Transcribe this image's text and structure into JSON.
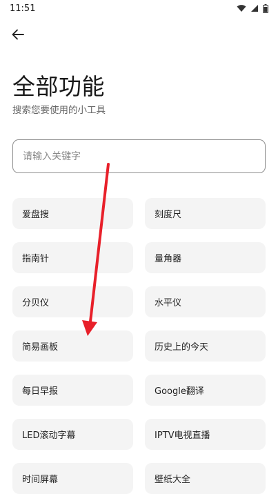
{
  "status_bar": {
    "time": "11:51",
    "icons": [
      "wifi-icon",
      "signal-icon",
      "battery-icon"
    ]
  },
  "header": {
    "back_icon": "arrow-left-icon",
    "title": "全部功能",
    "subtitle": "搜索您要使用的小工具"
  },
  "search": {
    "placeholder": "请输入关键字",
    "value": ""
  },
  "tools": [
    {
      "label": "爱盘搜"
    },
    {
      "label": "刻度尺"
    },
    {
      "label": "指南针"
    },
    {
      "label": "量角器"
    },
    {
      "label": "分贝仪"
    },
    {
      "label": "水平仪"
    },
    {
      "label": "简易画板"
    },
    {
      "label": "历史上的今天"
    },
    {
      "label": "每日早报"
    },
    {
      "label": "Google翻译"
    },
    {
      "label": "LED滚动字幕"
    },
    {
      "label": "IPTV电视直播"
    },
    {
      "label": "时间屏幕"
    },
    {
      "label": "壁纸大全"
    }
  ],
  "annotation": {
    "color": "#e8202a"
  }
}
